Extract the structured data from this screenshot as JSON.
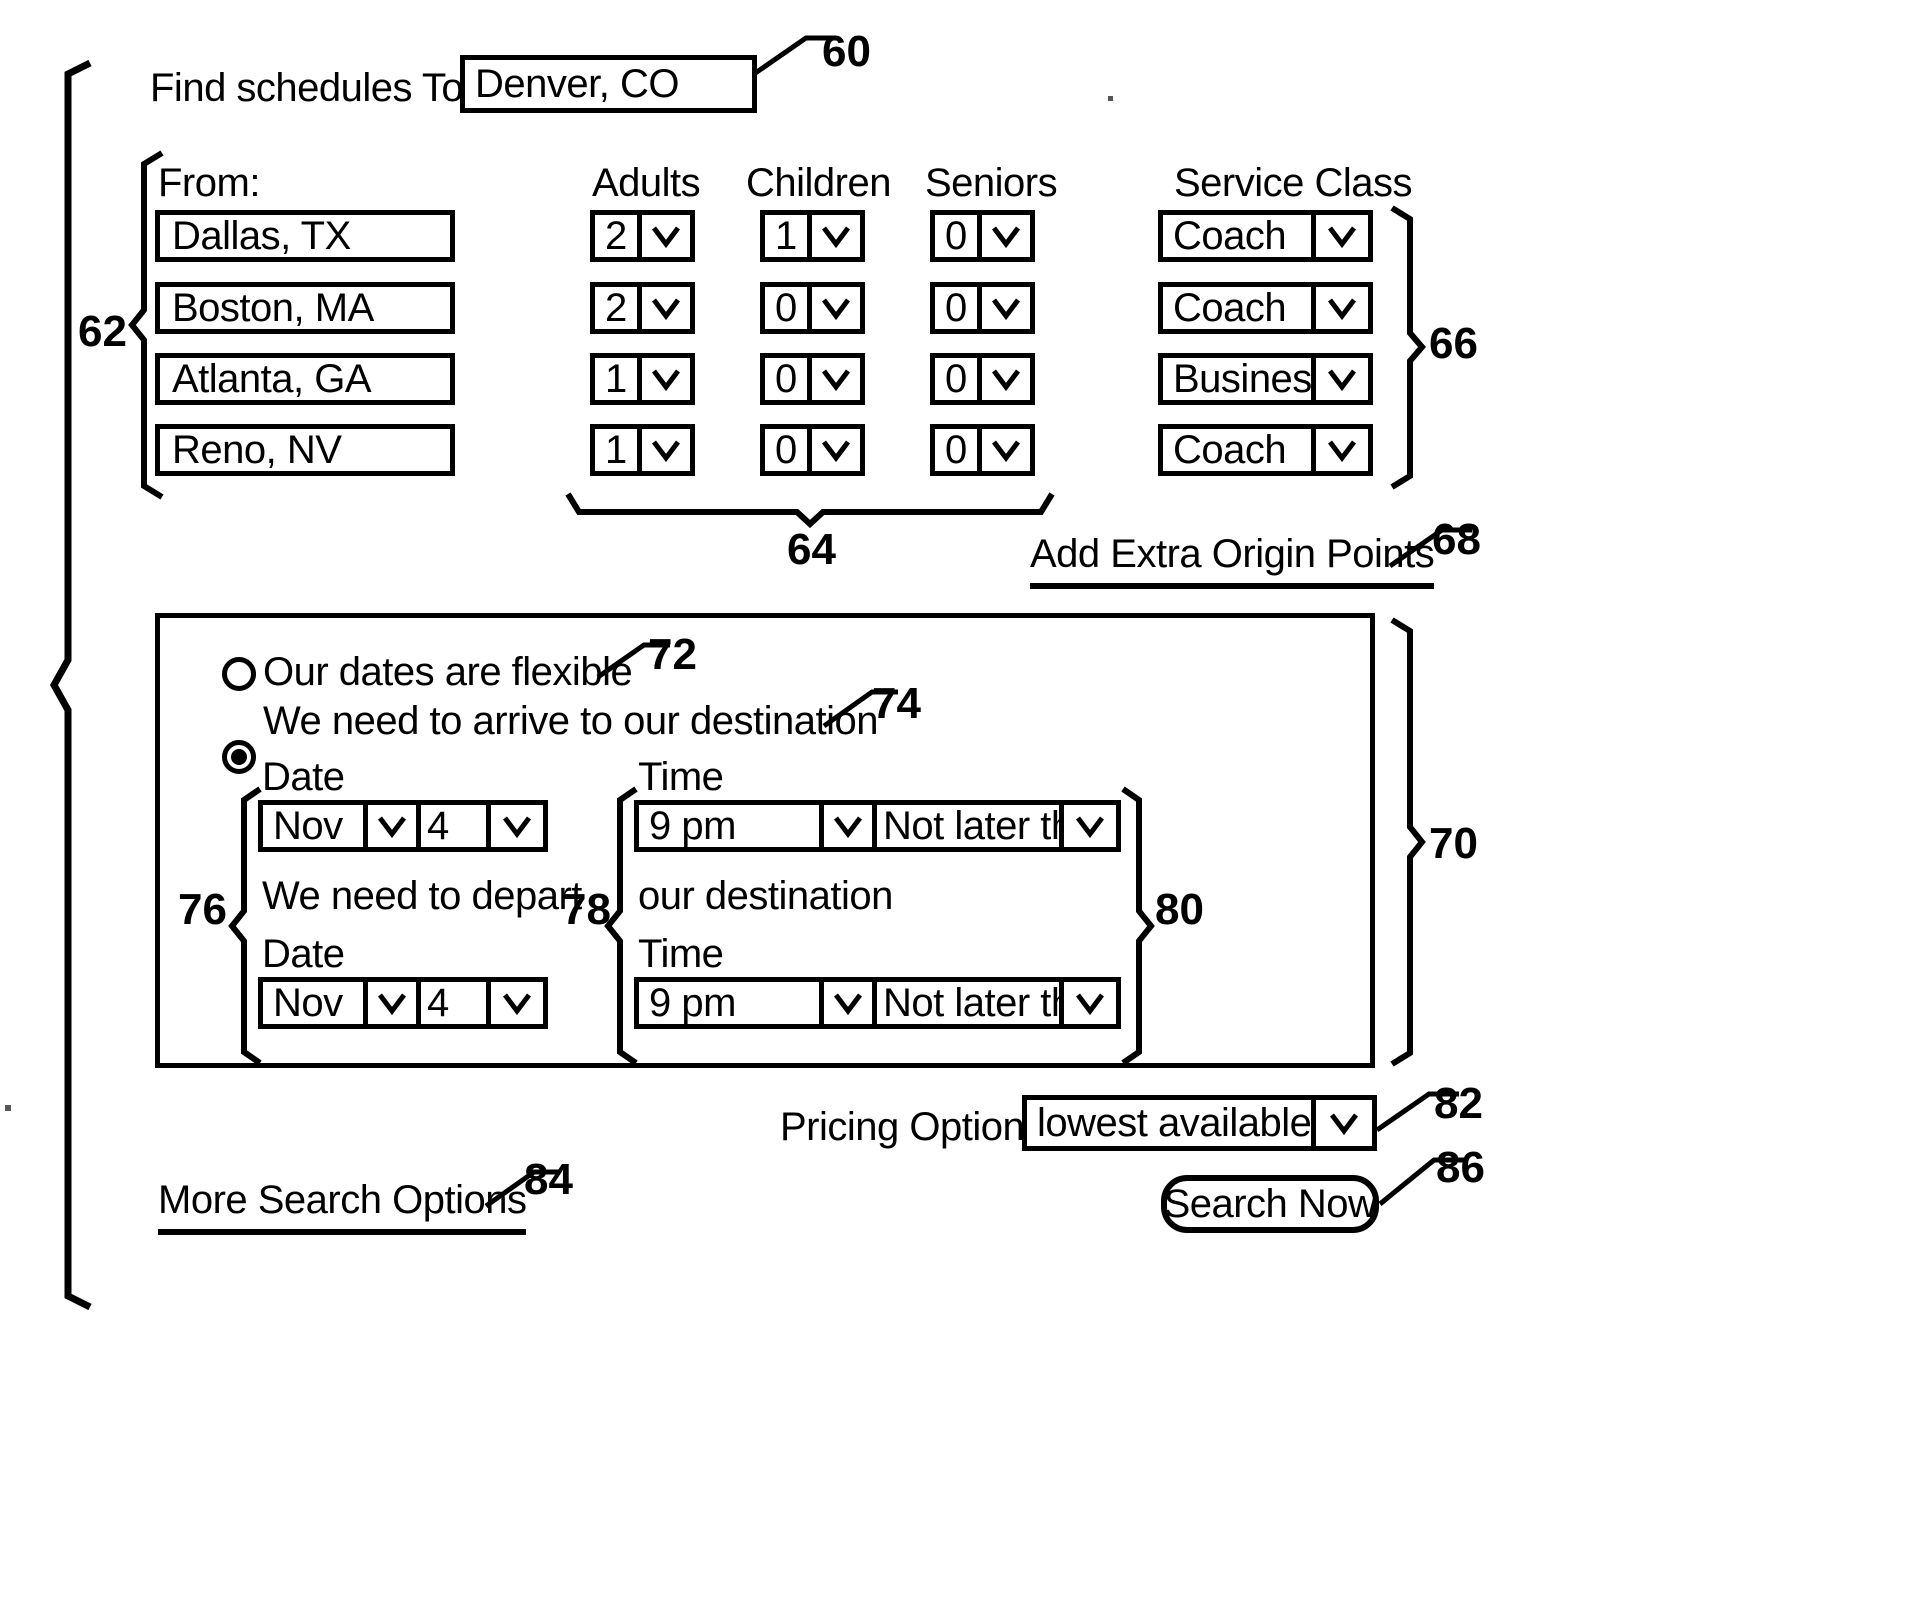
{
  "figure": {
    "destination_row": {
      "label": "Find schedules To:",
      "value": "Denver, CO",
      "ref": "60"
    },
    "origins": {
      "ref": "62",
      "header": "From:",
      "cities": [
        "Dallas, TX",
        "Boston, MA",
        "Atlanta, GA",
        "Reno, NV"
      ]
    },
    "passengers": {
      "ref": "64",
      "columns": [
        "Adults",
        "Children",
        "Seniors"
      ],
      "rows": [
        {
          "adults": "2",
          "children": "1",
          "seniors": "0"
        },
        {
          "adults": "2",
          "children": "0",
          "seniors": "0"
        },
        {
          "adults": "1",
          "children": "0",
          "seniors": "0"
        },
        {
          "adults": "1",
          "children": "0",
          "seniors": "0"
        }
      ]
    },
    "service_class": {
      "ref": "66",
      "header": "Service Class",
      "values": [
        "Coach",
        "Coach",
        "Business",
        "Coach"
      ]
    },
    "add_origin_link": {
      "label": "Add Extra Origin Points",
      "ref": "68"
    },
    "schedule_panel": {
      "ref": "70",
      "options": [
        {
          "label": "Our dates are flexible",
          "ref": "72",
          "selected": false
        },
        {
          "label": "We need to arrive to our destination",
          "ref": "74",
          "selected": true
        }
      ],
      "arrive_group": {
        "date_ref": "76",
        "time_ref": "78",
        "time_group_ref": "80",
        "date_label": "Date",
        "time_label": "Time",
        "month": "Nov",
        "day": "4",
        "time": "9 pm",
        "constraint": "Not later than"
      },
      "depart_group": {
        "lead_text": "We need to depart",
        "trail_text": "our destination",
        "date_label": "Date",
        "time_label": "Time",
        "month": "Nov",
        "day": "4",
        "time": "9 pm",
        "constraint": "Not later than"
      }
    },
    "pricing": {
      "label": "Pricing Option:",
      "value": "lowest available",
      "ref": "82"
    },
    "more_options_link": {
      "label": "More Search Options",
      "ref": "84"
    },
    "search_button": {
      "label": "Search Now",
      "ref": "86"
    }
  }
}
